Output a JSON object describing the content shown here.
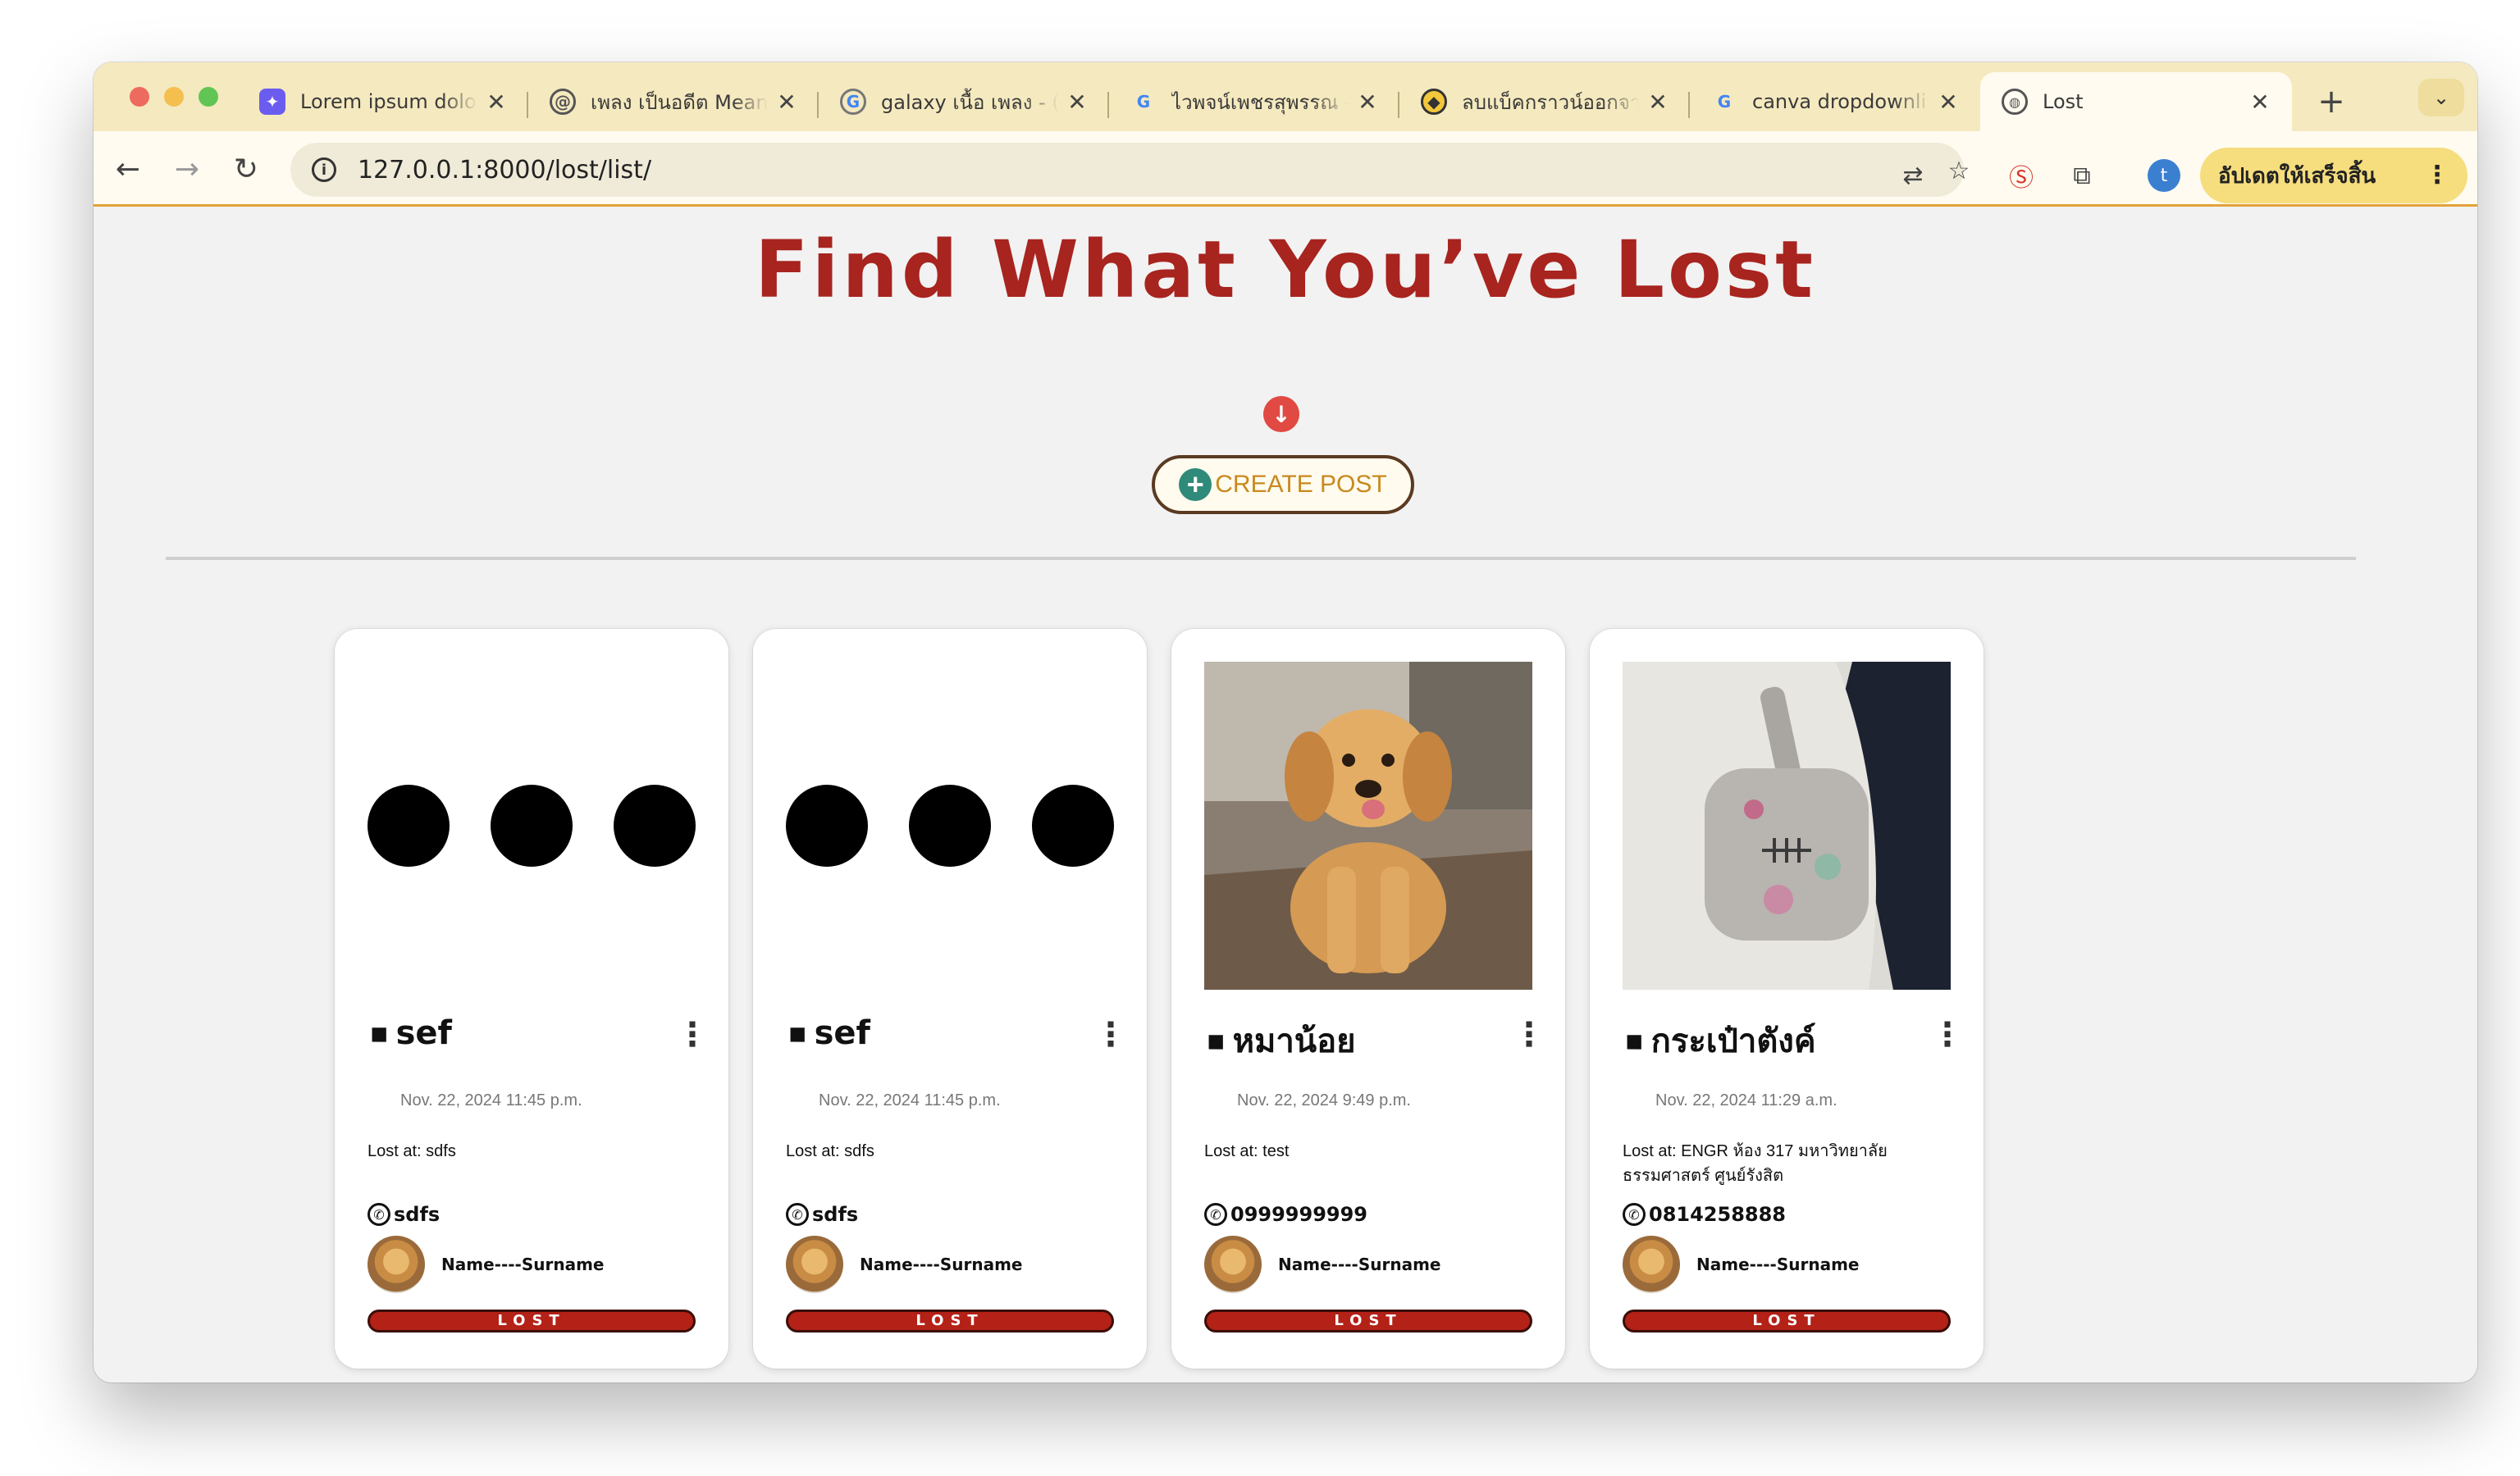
{
  "browser": {
    "tabs": [
      {
        "title": "Lorem ipsum dolo",
        "favicon": "ai-icon"
      },
      {
        "title": "เพลง เป็นอดีต Mean",
        "favicon": "spiral-icon"
      },
      {
        "title": "galaxy เนื้อ เพลง - (",
        "favicon": "google-icon"
      },
      {
        "title": "ไวพจน์เพชรสุพรรณ -",
        "favicon": "google-icon"
      },
      {
        "title": "ลบแบ็คกราวน์ออกจา",
        "favicon": "remove-bg-icon"
      },
      {
        "title": "canva dropdownli",
        "favicon": "google-icon"
      }
    ],
    "active_tab": {
      "title": "Lost",
      "favicon": "globe-icon"
    },
    "url": "127.0.0.1:8000/lost/list/",
    "profile_initial": "t",
    "update_label": "อัปเดตให้เสร็จสิ้น"
  },
  "page": {
    "title": "Find What You’ve Lost",
    "create_post_label": "CREATE POST",
    "accent_color": "#a8241f"
  },
  "posts": [
    {
      "title": "sef",
      "date": "Nov. 22, 2024  11:45 p.m.",
      "location": "Lost at: sdfs",
      "phone": "sdfs",
      "author": "Name----Surname",
      "status": "LOST",
      "image": "placeholder"
    },
    {
      "title": "sef",
      "date": "Nov. 22, 2024  11:45 p.m.",
      "location": "Lost at: sdfs",
      "phone": "sdfs",
      "author": "Name----Surname",
      "status": "LOST",
      "image": "placeholder"
    },
    {
      "title": "หมาน้อย",
      "date": "Nov. 22, 2024  9:49 p.m.",
      "location": "Lost at: test",
      "phone": "0999999999",
      "author": "Name----Surname",
      "status": "LOST",
      "image": "golden-retriever-puppy-photo"
    },
    {
      "title": "กระเป๋าตังค์",
      "date": "Nov. 22, 2024  11:29 a.m.",
      "location": "Lost at: ENGR ห้อง 317 มหาวิทยาลัยธรรมศาสตร์ ศูนย์รังสิต",
      "phone": "0814258888",
      "author": "Name----Surname",
      "status": "LOST",
      "image": "pouch-bag-photo"
    }
  ]
}
